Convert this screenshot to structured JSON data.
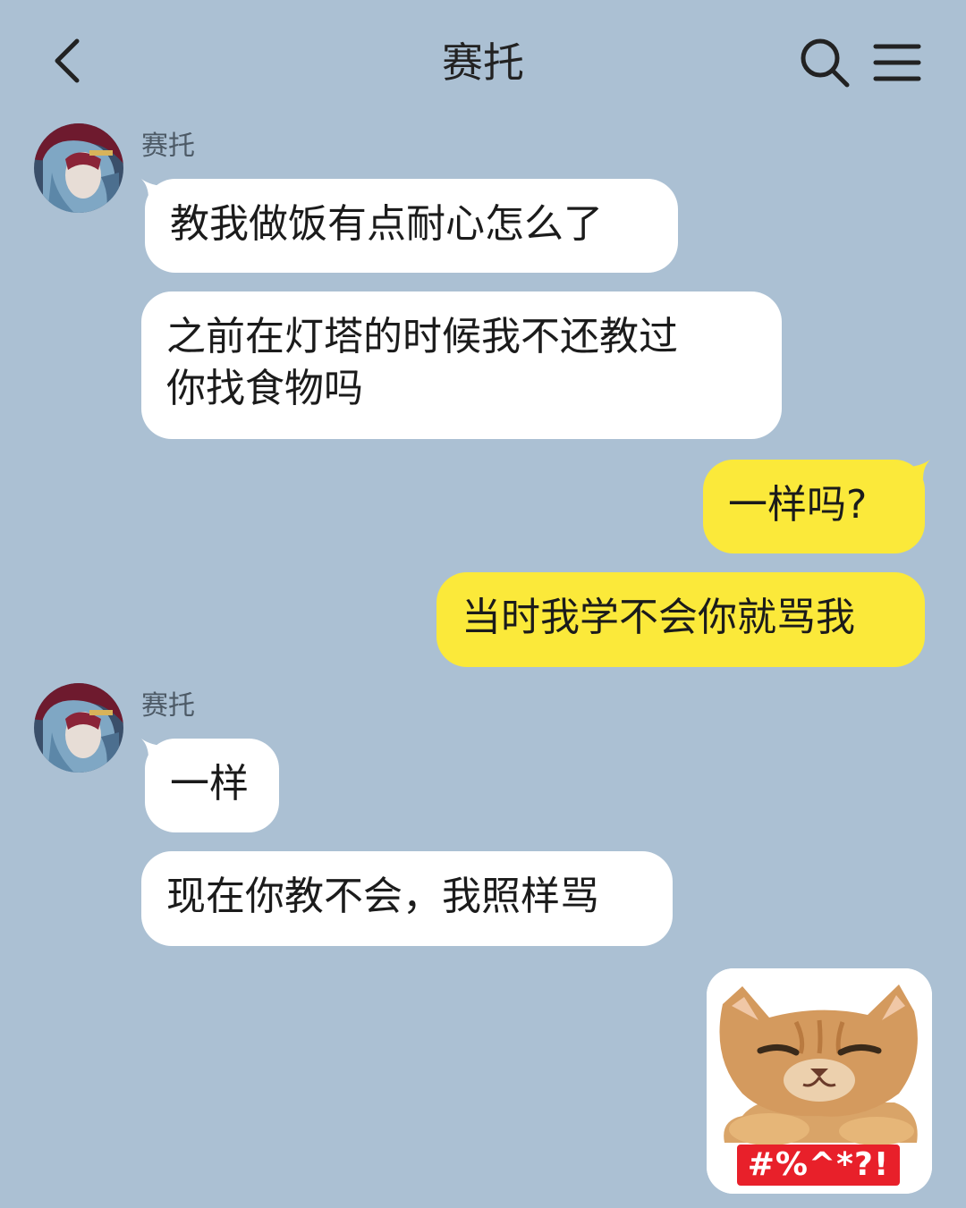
{
  "header": {
    "title": "赛托",
    "back_icon": "chevron-left-icon",
    "search_icon": "search-icon",
    "menu_icon": "menu-icon"
  },
  "colors": {
    "background": "#abc0d3",
    "incoming_bubble": "#ffffff",
    "outgoing_bubble": "#fbe93a"
  },
  "messages": [
    {
      "sender": "赛托",
      "side": "left",
      "text": "教我做饭有点耐心怎么了"
    },
    {
      "sender": "赛托",
      "side": "left",
      "text": "之前在灯塔的时候我不还教过\n你找食物吗"
    },
    {
      "sender": "me",
      "side": "right",
      "text": "一样吗?"
    },
    {
      "sender": "me",
      "side": "right",
      "text": "当时我学不会你就骂我"
    },
    {
      "sender": "赛托",
      "side": "left",
      "text": "一样"
    },
    {
      "sender": "赛托",
      "side": "left",
      "text": "现在你教不会，我照样骂"
    },
    {
      "sender": "me",
      "side": "right",
      "type": "sticker",
      "sticker_icon": "angry-cat-sticker",
      "sticker_text": "#%^*?!"
    }
  ]
}
